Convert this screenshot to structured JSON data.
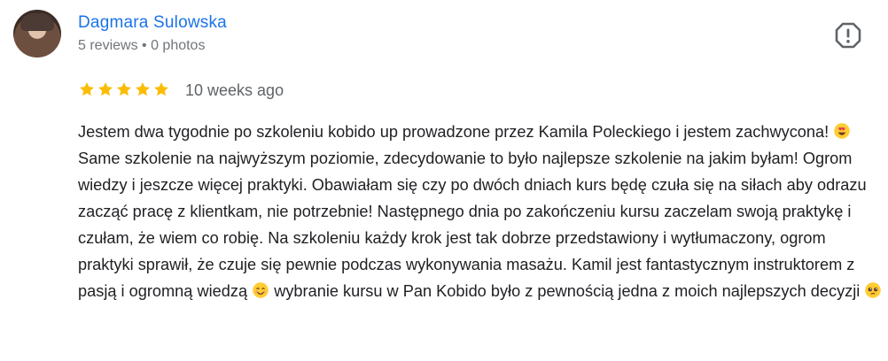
{
  "reviewer": {
    "name": "Dagmara Sulowska",
    "meta": "5 reviews • 0 photos",
    "avatar_icon": "profile-photo"
  },
  "review": {
    "rating": 5,
    "rating_max": 5,
    "time": "10 weeks ago",
    "text_parts": [
      "Jestem dwa tygodnie po szkoleniu kobido up prowadzone przez Kamila Poleckiego i jestem zachwycona! ",
      " Same szkolenie na najwyższym poziomie, zdecydowanie to było najlepsze szkolenie na jakim byłam! Ogrom wiedzy i jeszcze więcej praktyki. Obawiałam się czy po dwóch dniach kurs będę czuła się na siłach aby odrazu zacząć pracę z klientkam, nie potrzebnie! Następnego dnia po zakończeniu kursu zaczelam swoją praktykę i czułam, że wiem co robię. Na szkoleniu każdy krok jest tak dobrze przedstawiony i wytłumaczony, ogrom praktyki sprawił, że czuje się pewnie podczas wykonywania masażu. Kamil jest fantastycznym instruktorem z pasją i ogromną wiedzą ",
      " wybranie kursu w Pan Kobido było z pewnością jedna z moich najlepszych decyzji "
    ],
    "emojis": [
      "heart-eyes-emoji",
      "smiling-blush-emoji",
      "pleading-face-emoji"
    ]
  },
  "icons": {
    "report": "report-octagon-icon",
    "star": "star-icon"
  },
  "colors": {
    "name": "#1a73e8",
    "meta": "#70757a",
    "star": "#fbbc04",
    "text": "#202124"
  }
}
